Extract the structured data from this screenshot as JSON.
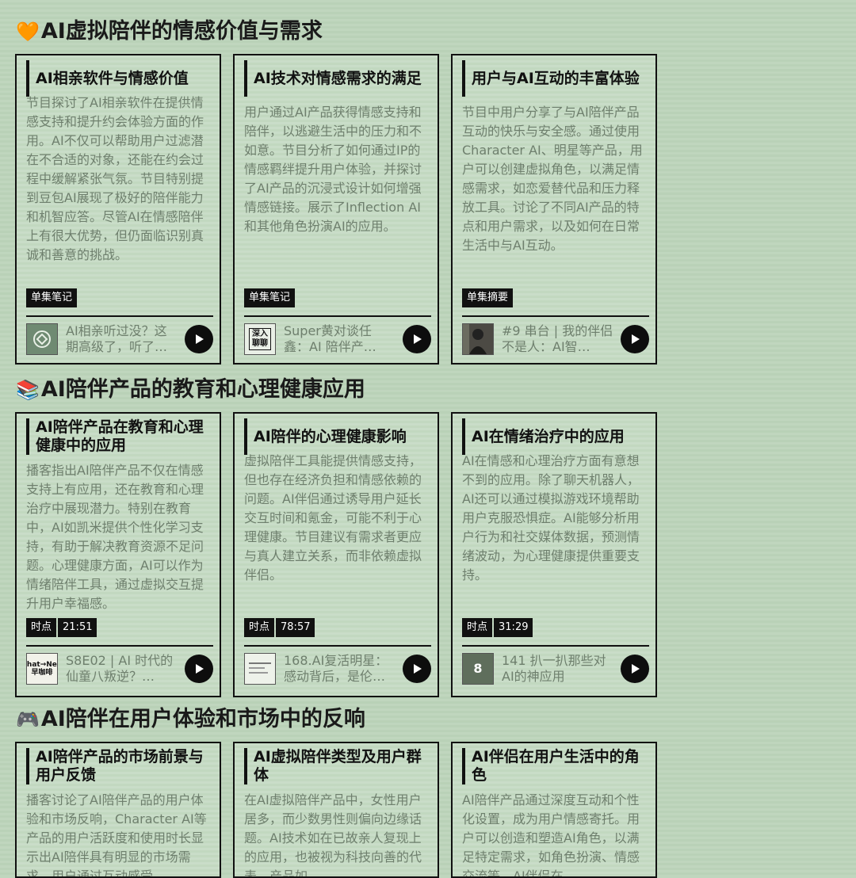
{
  "sections": [
    {
      "emoji": "🧡",
      "title": "AI虚拟陪伴的情感价值与需求",
      "cards": [
        {
          "title": "AI相亲软件与情感价值",
          "body": "节目探讨了AI相亲软件在提供情感支持和提升约会体验方面的作用。AI不仅可以帮助用户过滤潜在不合适的对象，还能在约会过程中缓解紧张气氛。节目特别提到豆包AI展现了极好的陪伴能力和机智应答。尽管AI在情感陪伴上有很大优势，但仍面临识别真诚和善意的挑战。",
          "tags": [
            "单集笔记"
          ],
          "episode": "AI相亲听过没？这期高级了，听了…",
          "thumb": "logo-thumb"
        },
        {
          "title": "AI技术对情感需求的满足",
          "body": "用户通过AI产品获得情感支持和陪伴，以逃避生活中的压力和不如意。节目分析了如何通过IP的情感羁绊提升用户体验，并探讨了AI产品的沉浸式设计如何增强情感链接。展示了Inflection AI和其他角色扮演AI的应用。",
          "tags": [
            "单集笔记"
          ],
          "episode": "Super黄对谈任鑫：AI 陪伴产…",
          "thumb": "深入聊聊"
        },
        {
          "title": "用户与AI互动的丰富体验",
          "body": "节目中用户分享了与AI陪伴产品互动的快乐与安全感。通过使用Character AI、明星等产品，用户可以创建虚拟角色，以满足情感需求，如恋爱替代品和压力释放工具。讨论了不同AI产品的特点和用户需求，以及如何在日常生活中与AI互动。",
          "tags": [
            "单集摘要"
          ],
          "episode": "#9 串台 | 我的伴侣不是人：AI智…",
          "thumb": "photo-thumb"
        }
      ]
    },
    {
      "emoji": "📚",
      "title": "AI陪伴产品的教育和心理健康应用",
      "cards": [
        {
          "title": "AI陪伴产品在教育和心理健康中的应用",
          "body": "播客指出AI陪伴产品不仅在情感支持上有应用，还在教育和心理治疗中展现潜力。特别在教育中，AI如凯米提供个性化学习支持，有助于解决教育资源不足问题。心理健康方面，AI可以作为情绪陪伴工具，通过虚拟交互提升用户幸福感。",
          "tags": [
            "时点",
            "21:51"
          ],
          "episode": "S8E02 | AI 时代的仙童八叛逆？…",
          "thumb": "What→Next 早咖啡"
        },
        {
          "title": "AI陪伴的心理健康影响",
          "body": "虚拟陪伴工具能提供情感支持，但也存在经济负担和情感依赖的问题。AI伴侣通过诱导用户延长交互时间和氪金，可能不利于心理健康。节目建议有需求者更应与真人建立关系，而非依赖虚拟伴侣。",
          "tags": [
            "时点",
            "78:57"
          ],
          "episode": "168.AI复活明星：感动背后，是伦…",
          "thumb": "doc-thumb"
        },
        {
          "title": "AI在情绪治疗中的应用",
          "body": "AI在情感和心理治疗方面有意想不到的应用。除了聊天机器人，AI还可以通过模拟游戏环境帮助用户克服恐惧症。AI能够分析用户行为和社交媒体数据，预测情绪波动，为心理健康提供重要支持。",
          "tags": [
            "时点",
            "31:29"
          ],
          "episode": "141 扒一扒那些对AI的神应用",
          "thumb": "8"
        }
      ]
    },
    {
      "emoji": "🎮",
      "title": "AI陪伴在用户体验和市场中的反响",
      "cards": [
        {
          "title": "AI陪伴产品的市场前景与用户反馈",
          "body": "播客讨论了AI陪伴产品的用户体验和市场反响，Character AI等产品的用户活跃度和使用时长显示出AI陪伴具有明显的市场需求。用户通过互动感受",
          "tags": [],
          "episode": "",
          "thumb": ""
        },
        {
          "title": "AI虚拟陪伴类型及用户群体",
          "body": "在AI虚拟陪伴产品中，女性用户居多，而少数男性则偏向边缘话题。AI技术如在已故亲人复现上的应用，也被视为科技向善的代表。产品如",
          "tags": [],
          "episode": "",
          "thumb": ""
        },
        {
          "title": "AI伴侣在用户生活中的角色",
          "body": "AI陪伴产品通过深度互动和个性化设置，成为用户情感寄托。用户可以创造和塑造AI角色，以满足特定需求，如角色扮演、情感交流等。AI伴侣在",
          "tags": [],
          "episode": "",
          "thumb": ""
        }
      ]
    }
  ],
  "colors": {
    "background": "#b9d1b7",
    "card_border": "#111111",
    "body_text": "#6e7f6d",
    "tag_bg": "#111111",
    "play_button": "#0d0d0d"
  },
  "icons": {
    "play": "play-icon"
  }
}
